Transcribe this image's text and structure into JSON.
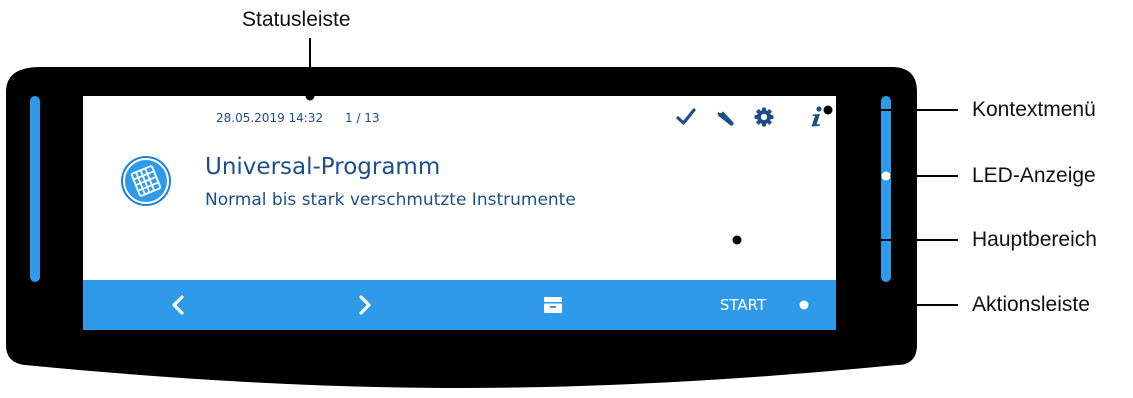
{
  "labels": {
    "statusbar": "Statusleiste",
    "context_menu": "Kontextmenü",
    "led": "LED-Anzeige",
    "main_area": "Hauptbereich",
    "action_bar": "Aktionsleiste"
  },
  "status": {
    "datetime": "28.05.2019 14:32",
    "page": "1 / 13"
  },
  "context_icons": [
    "checkmark-icon",
    "wrench-icon",
    "gear-icon",
    "info-icon"
  ],
  "program": {
    "icon": "instrument-tray-icon",
    "title": "Universal-Programm",
    "subtitle": "Normal bis stark verschmutzte Instrumente"
  },
  "actions": {
    "prev_icon": "chevron-left-icon",
    "next_icon": "chevron-right-icon",
    "drawer_icon": "drawer-icon",
    "start_label": "START"
  },
  "colors": {
    "bezel": "#000000",
    "led": "#2f9be8",
    "accent": "#2f9be8",
    "text": "#1d4e8c"
  }
}
